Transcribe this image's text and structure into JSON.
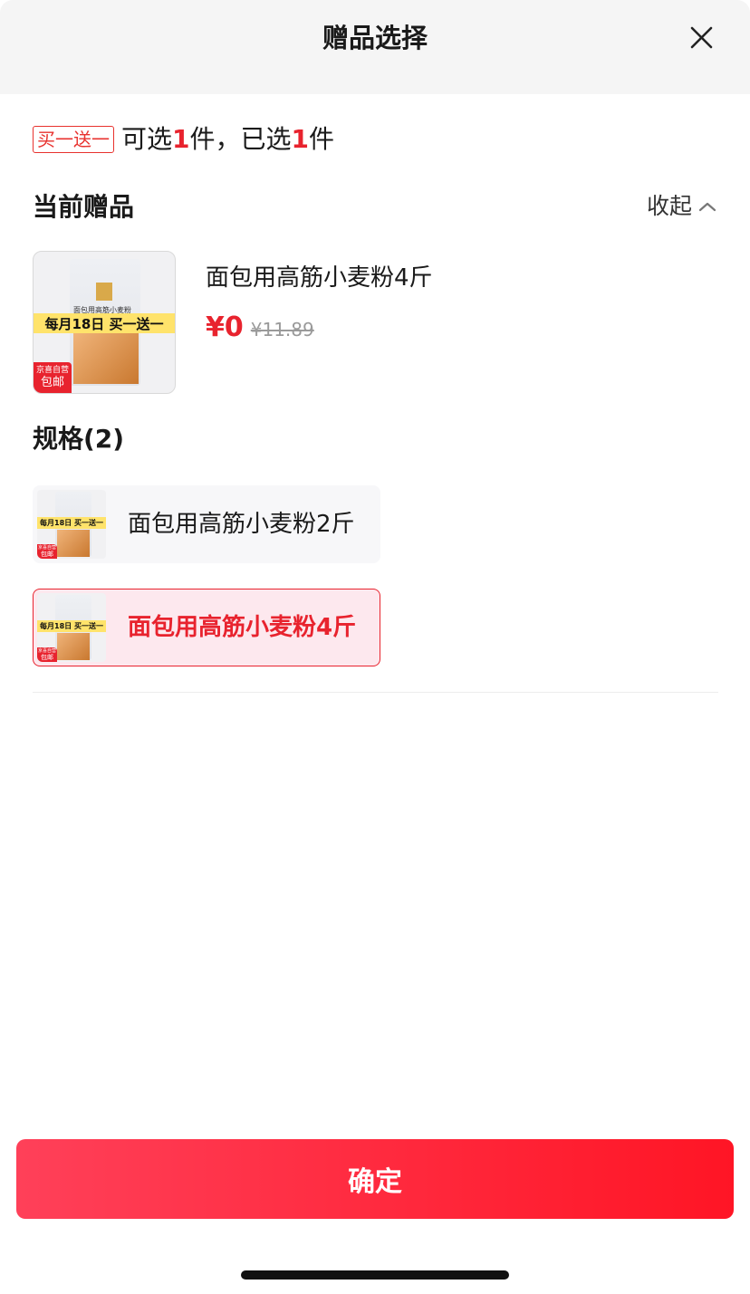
{
  "header": {
    "title": "赠品选择"
  },
  "promo": {
    "tag": "买一送一",
    "text_prefix": "可选",
    "selectable_count": "1",
    "text_mid": "件，已选",
    "selected_count": "1",
    "text_suffix": "件"
  },
  "current_gift": {
    "section_title": "当前赠品",
    "collapse_label": "收起",
    "name": "面包用高筋小麦粉4斤",
    "price": "¥0",
    "original_price": "¥11.89",
    "thumb": {
      "banner": "每月18日 买一送一",
      "badge_top": "京喜自营",
      "badge_bottom": "包邮",
      "bag_title": "面包用高筋小麦粉"
    }
  },
  "specs": {
    "title": "规格(2)",
    "options": [
      {
        "label": "面包用高筋小麦粉2斤",
        "banner": "每月18日 买一送一",
        "badge_top": "京喜自营",
        "badge_bottom": "包邮"
      },
      {
        "label": "面包用高筋小麦粉4斤",
        "banner": "每月18日 买一送一",
        "badge_top": "京喜自营",
        "badge_bottom": "包邮"
      }
    ]
  },
  "footer": {
    "confirm_label": "确定"
  },
  "colors": {
    "accent": "#e8232e",
    "button_start": "#ff4059",
    "button_end": "#ff1525"
  },
  "icons": {
    "close": "close-icon",
    "collapse": "chevron-up-icon"
  }
}
